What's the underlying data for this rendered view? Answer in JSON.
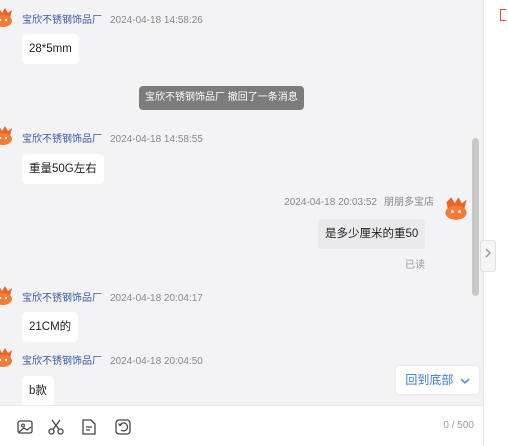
{
  "messages": [
    {
      "sender": "宝欣不锈钢饰品厂",
      "time": "2024-04-18 14:58:26",
      "text": "28*5mm"
    },
    {
      "system": "宝欣不锈钢饰品厂 撤回了一条消息"
    },
    {
      "sender": "宝欣不锈钢饰品厂",
      "time": "2024-04-18 14:58:55",
      "text": "重量50G左右"
    },
    {
      "sender": "朋朋多宝店",
      "time": "2024-04-18 20:03:52",
      "text": "是多少厘米的重50",
      "status": "已读"
    },
    {
      "sender": "宝欣不锈钢饰品厂",
      "time": "2024-04-18 20:04:17",
      "text": "21CM的"
    },
    {
      "sender": "宝欣不锈钢饰品厂",
      "time": "2024-04-18 20:04:50",
      "text": "b款"
    }
  ],
  "back_to_bottom_label": "回到底部",
  "char_counter": "0 / 500",
  "toolbar_icons": [
    "image-icon",
    "scissors-icon",
    "file-icon",
    "history-icon"
  ],
  "colors": {
    "sender_name": "#3b5aa6",
    "link": "#3a7bd5",
    "system_bg": "#7c7c7c"
  }
}
